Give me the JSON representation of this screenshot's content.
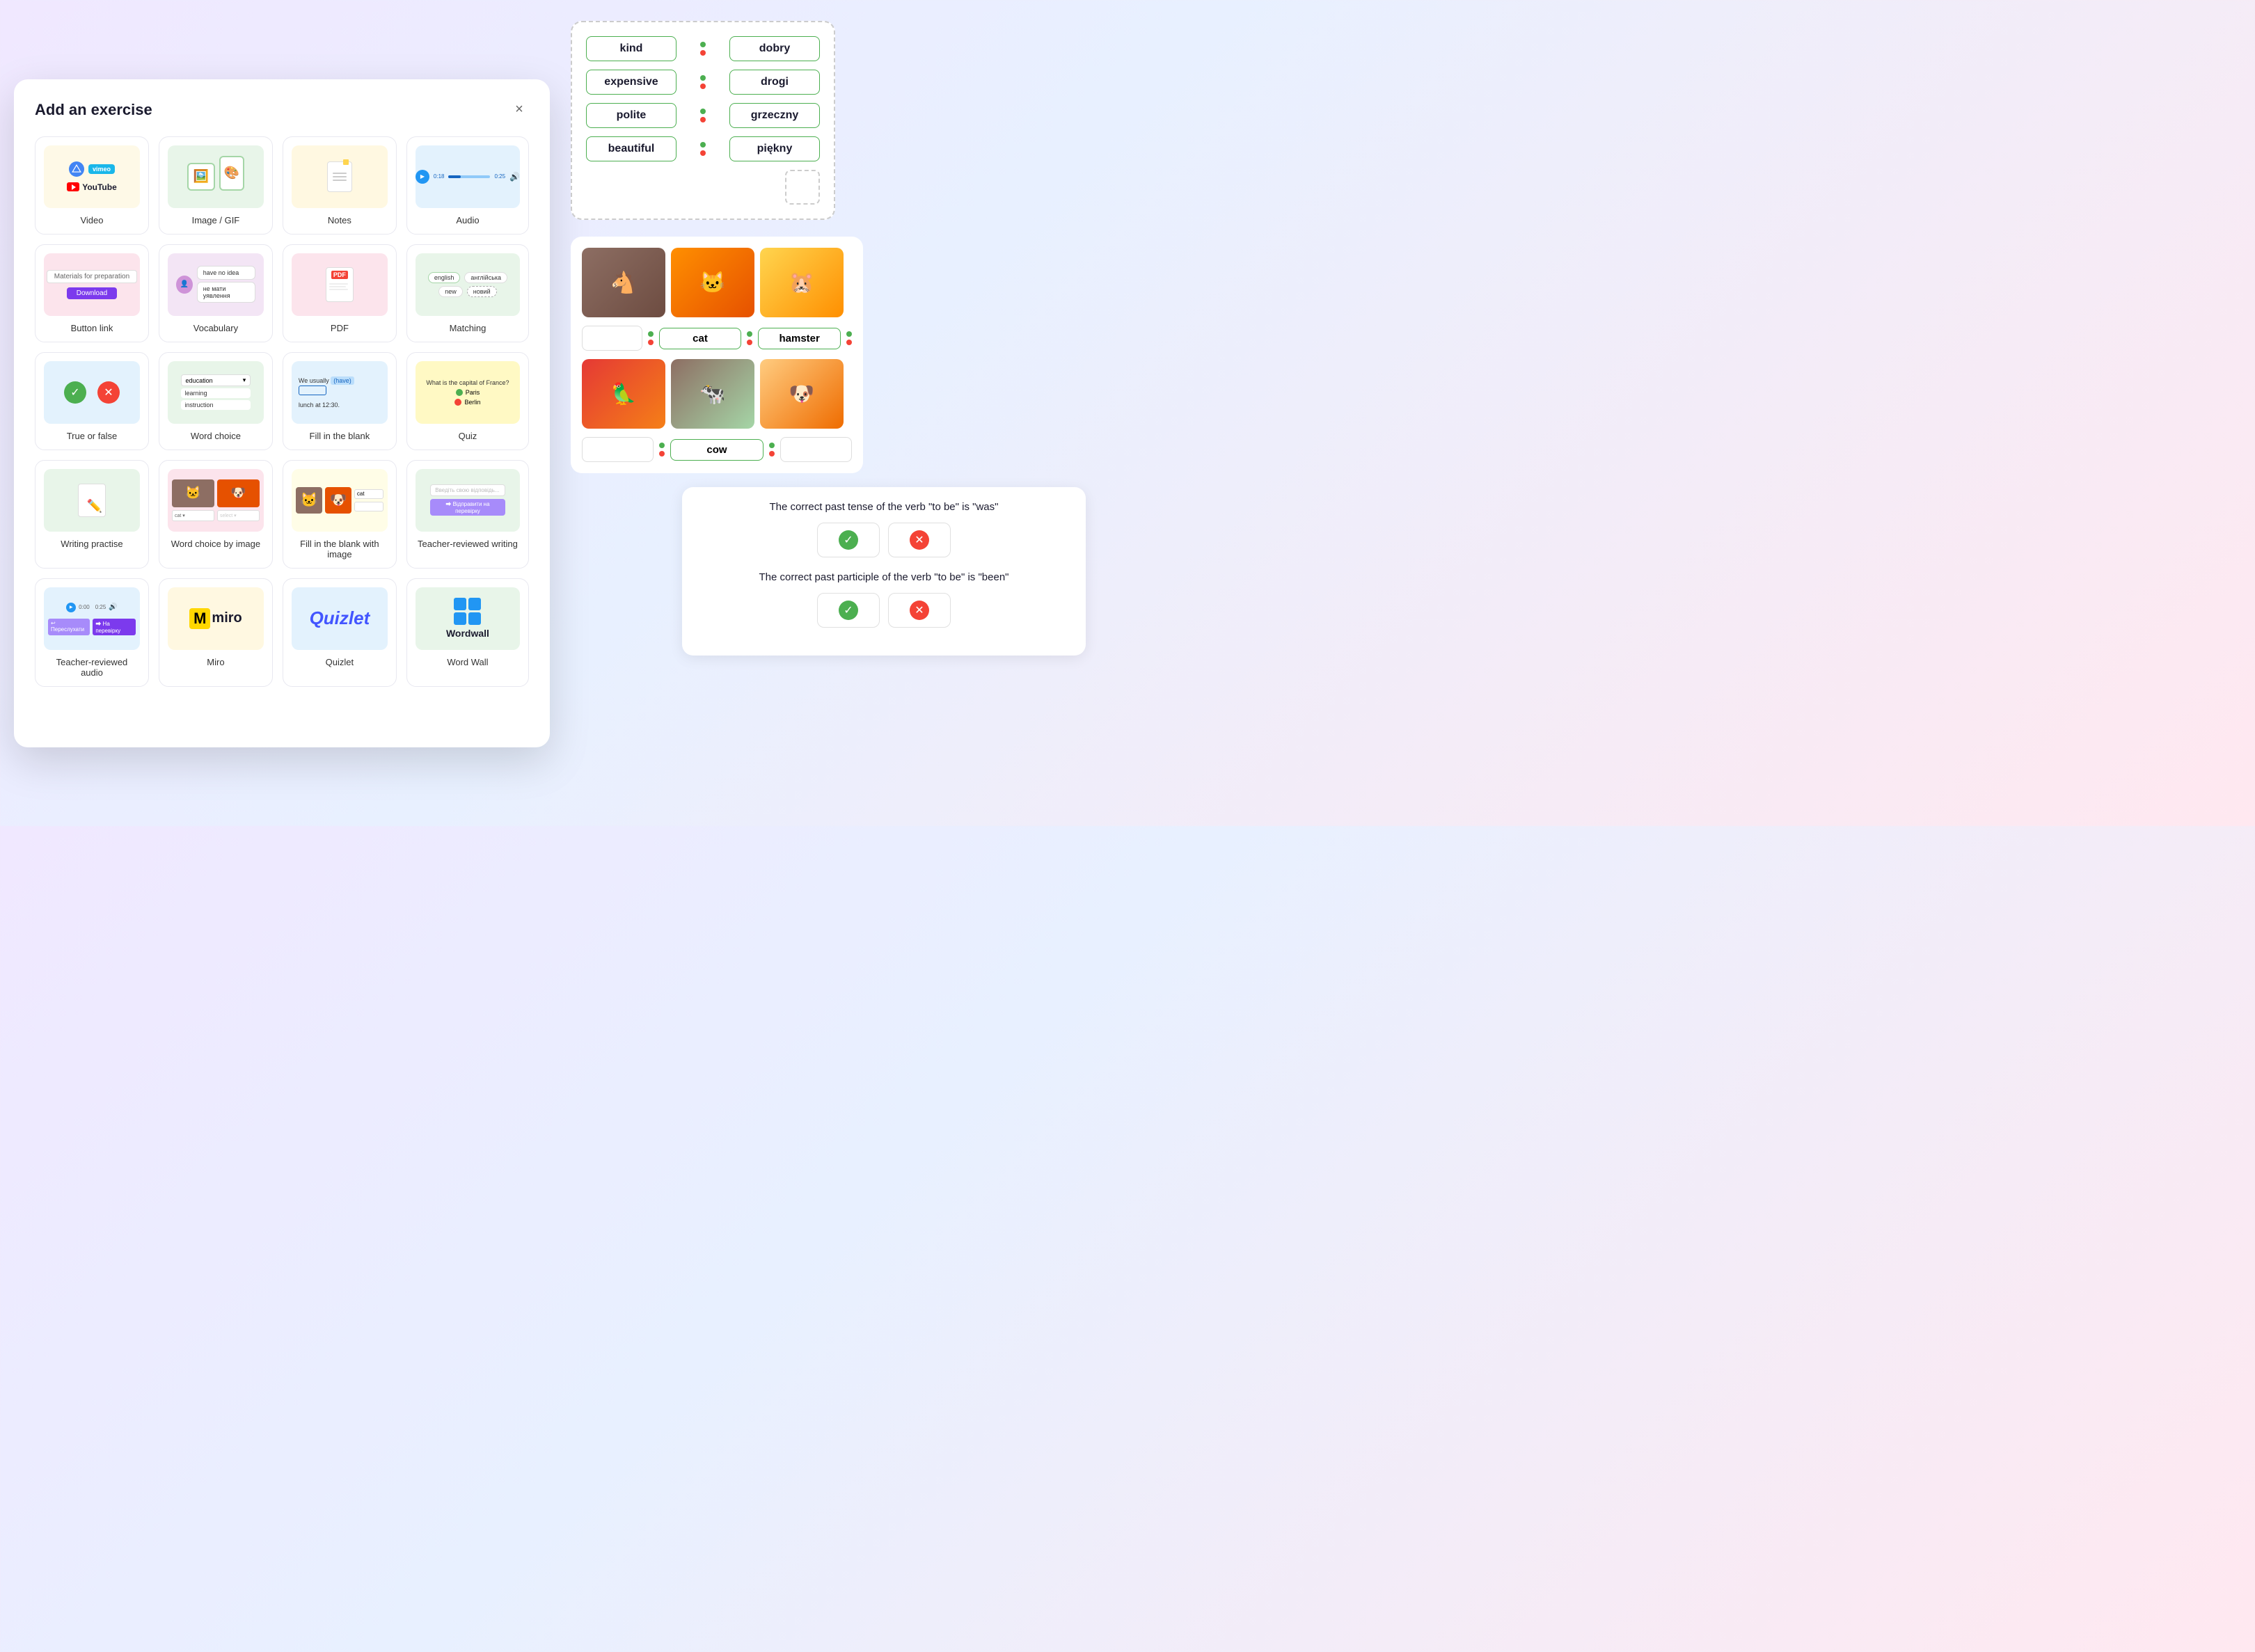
{
  "modal": {
    "title": "Add an exercise",
    "close_label": "×"
  },
  "cards": [
    {
      "id": "video",
      "label": "Video"
    },
    {
      "id": "image-gif",
      "label": "Image / GIF"
    },
    {
      "id": "notes",
      "label": "Notes"
    },
    {
      "id": "audio",
      "label": "Audio"
    },
    {
      "id": "button-link",
      "label": "Button link"
    },
    {
      "id": "vocabulary",
      "label": "Vocabulary"
    },
    {
      "id": "pdf",
      "label": "PDF"
    },
    {
      "id": "matching",
      "label": "Matching"
    },
    {
      "id": "true-false",
      "label": "True or false"
    },
    {
      "id": "word-choice",
      "label": "Word choice"
    },
    {
      "id": "fill-blank",
      "label": "Fill in the blank"
    },
    {
      "id": "quiz",
      "label": "Quiz"
    },
    {
      "id": "writing",
      "label": "Writing practise"
    },
    {
      "id": "word-choice-image",
      "label": "Word choice by image"
    },
    {
      "id": "fill-blank-image",
      "label": "Fill in the blank with image"
    },
    {
      "id": "teacher-writing",
      "label": "Teacher-reviewed writing"
    },
    {
      "id": "teacher-audio",
      "label": "Teacher-reviewed audio"
    },
    {
      "id": "miro",
      "label": "Miro"
    },
    {
      "id": "quizlet",
      "label": "Quizlet"
    },
    {
      "id": "wordwall",
      "label": "Word Wall"
    }
  ],
  "matching_exercise": {
    "pairs": [
      {
        "left": "kind",
        "right": "dobry"
      },
      {
        "left": "expensive",
        "right": "drogi"
      },
      {
        "left": "polite",
        "right": "grzeczny"
      },
      {
        "left": "beautiful",
        "right": "piękny"
      }
    ]
  },
  "animal_exercise": {
    "images": [
      "🐴",
      "🐱",
      "🐹"
    ],
    "images_row2": [
      "🦜",
      "🐄",
      "🐶"
    ],
    "labels_row1": [
      "cat",
      "hamster"
    ],
    "labels_row2": [
      "cow"
    ],
    "empty_slots": 3
  },
  "quiz_exercise": {
    "statement1": "The correct past tense of the verb \"to be\" is \"was\"",
    "statement2": "The correct past participle of the verb \"to be\" is \"been\""
  },
  "word_choice_preview": {
    "dropdown": "education",
    "options": [
      "learning",
      "instruction"
    ]
  },
  "fill_blank_preview": {
    "text": "We usually (have)",
    "suffix": "lunch at 12:30."
  },
  "quiz_preview": {
    "question": "What is the capital of France?",
    "option1": "Paris",
    "option2": "Berlin"
  },
  "vocab_preview": {
    "text1": "have no idea",
    "text2": "не мати уявлення"
  },
  "button_link_preview": {
    "label": "Materials for preparation",
    "btn": "Download"
  }
}
